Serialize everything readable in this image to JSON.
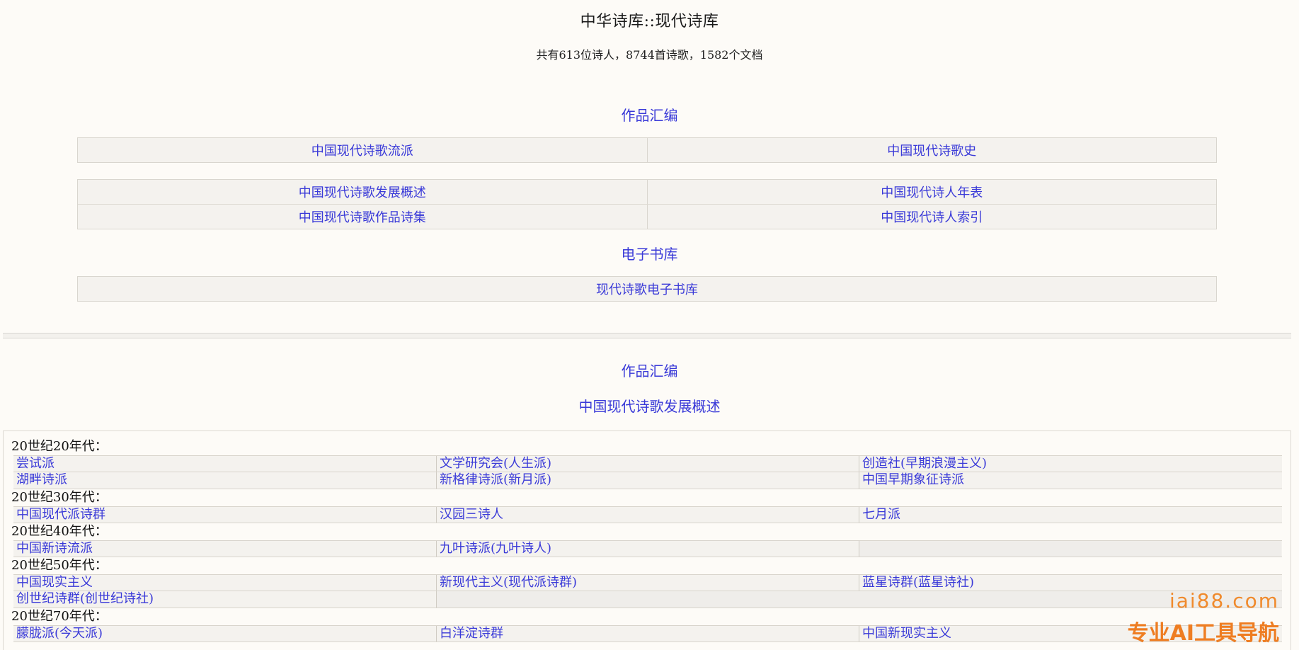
{
  "header": {
    "title": "中华诗库::现代诗库",
    "stats": "共有613位诗人，8744首诗歌，1582个文档"
  },
  "top": {
    "section1_heading": "作品汇编",
    "section1_group1": [
      "中国现代诗歌流派",
      "中国现代诗歌史"
    ],
    "section1_group2": [
      [
        "中国现代诗歌发展概述",
        "中国现代诗人年表"
      ],
      [
        "中国现代诗歌作品诗集",
        "中国现代诗人索引"
      ]
    ],
    "section2_heading": "电子书库",
    "ebook_link": "现代诗歌电子书库"
  },
  "lower": {
    "heading": "作品汇编",
    "subheading": "中国现代诗歌发展概述",
    "eras": [
      {
        "label": "20世纪20年代：",
        "rows": [
          [
            "尝试派",
            "文学研究会(人生派)",
            "创造社(早期浪漫主义)"
          ],
          [
            "湖畔诗派",
            "新格律诗派(新月派)",
            "中国早期象征诗派"
          ]
        ]
      },
      {
        "label": "20世纪30年代：",
        "rows": [
          [
            "中国现代派诗群",
            "汉园三诗人",
            "七月派"
          ]
        ]
      },
      {
        "label": "20世纪40年代：",
        "rows": [
          [
            "中国新诗流派",
            "九叶诗派(九叶诗人)",
            ""
          ]
        ]
      },
      {
        "label": "20世纪50年代：",
        "rows": [
          [
            "中国现实主义",
            "新现代主义(现代派诗群)",
            "蓝星诗群(蓝星诗社)"
          ],
          [
            "创世纪诗群(创世纪诗社)"
          ]
        ]
      },
      {
        "label": "20世纪70年代：",
        "rows": [
          [
            "朦胧派(今天派)",
            "白洋淀诗群",
            "中国新现实主义"
          ]
        ]
      }
    ]
  },
  "watermark": {
    "url": "iai88.com",
    "text": "专业AI工具导航"
  },
  "colors": {
    "link": "#3a3ad8",
    "background": "#fdfbf7",
    "watermark": "#ee7d22"
  }
}
